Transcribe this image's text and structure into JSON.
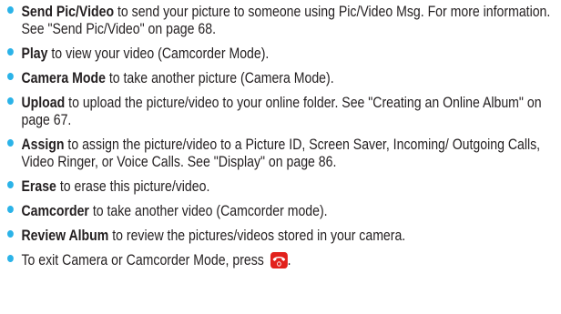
{
  "items": [
    {
      "term": "Send Pic/Video",
      "text": " to send your picture to someone using Pic/Video Msg. For more information. See \"Send Pic/Video\" on page 68."
    },
    {
      "term": "Play",
      "text": " to view your video (Camcorder Mode)."
    },
    {
      "term": "Camera Mode",
      "text": " to take another picture (Camera Mode)."
    },
    {
      "term": "Upload",
      "text": " to upload the picture/video to your online folder. See \"Creating an Online Album\" on page 67."
    },
    {
      "term": "Assign",
      "text": " to assign the picture/video to a Picture ID, Screen Saver, Incoming/ Outgoing Calls, Video Ringer, or Voice Calls. See \"Display\" on page 86."
    },
    {
      "term": "Erase",
      "text": " to erase this picture/video."
    },
    {
      "term": "Camcorder",
      "text": " to take another video (Camcorder mode)."
    },
    {
      "term": "Review Album",
      "text": " to review the pictures/videos stored in your camera."
    }
  ],
  "exit_text": "To exit Camera or Camcorder Mode, press",
  "exit_period": ".",
  "colors": {
    "bullet": "#2bb3e8",
    "end_key": "#e2211c",
    "text": "#231f20"
  },
  "icons": {
    "end_key": "end-key-icon"
  }
}
